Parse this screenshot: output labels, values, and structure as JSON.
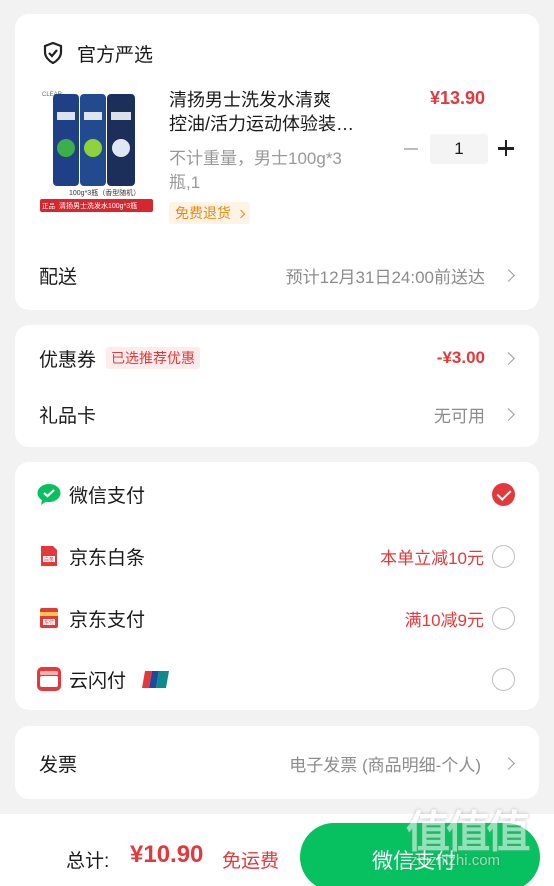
{
  "store": {
    "name": "官方严选"
  },
  "product": {
    "title": "清扬男士洗发水清爽控油/活力运动体验装…",
    "title_line1": "清扬男士洗发水清爽",
    "title_line2": "控油/活力运动体验装…",
    "price": "¥13.90",
    "spec_line1": "不计重量，男士100g*3",
    "spec_line2": "瓶,1",
    "quantity": "1",
    "tag": "免费退货",
    "image_caption_small": "100g*3瓶（香型随机）",
    "image_caption_banner": "清扬男士洗发水100g*3瓶",
    "image_badge": "正品保障"
  },
  "delivery": {
    "label": "配送",
    "value": "预计12月31日24:00前送达"
  },
  "coupon": {
    "label": "优惠券",
    "badge": "已选推荐优惠",
    "value": "-¥3.00"
  },
  "giftcard": {
    "label": "礼品卡",
    "value": "无可用"
  },
  "payments": [
    {
      "name": "微信支付",
      "promo": "",
      "selected": true,
      "icon": "wechat-pay-icon"
    },
    {
      "name": "京东白条",
      "promo": "本单立减10元",
      "selected": false,
      "icon": "jd-baitiao-icon"
    },
    {
      "name": "京东支付",
      "promo": "满10减9元",
      "selected": false,
      "icon": "jd-pay-icon"
    },
    {
      "name": "云闪付",
      "promo": "",
      "selected": false,
      "icon": "union-quickpass-icon"
    }
  ],
  "invoice": {
    "label": "发票",
    "value": "电子发票 (商品明细-个人)"
  },
  "footer": {
    "total_label": "总计:",
    "total_value": "¥10.90",
    "shipping": "免运费",
    "pay_button": "微信支付"
  },
  "watermark": {
    "text": "值 值 值",
    "url": "zhizhizhi.com"
  },
  "colors": {
    "accent": "#e4393c",
    "wechat_green": "#07c160",
    "background": "#f2f2f2"
  }
}
